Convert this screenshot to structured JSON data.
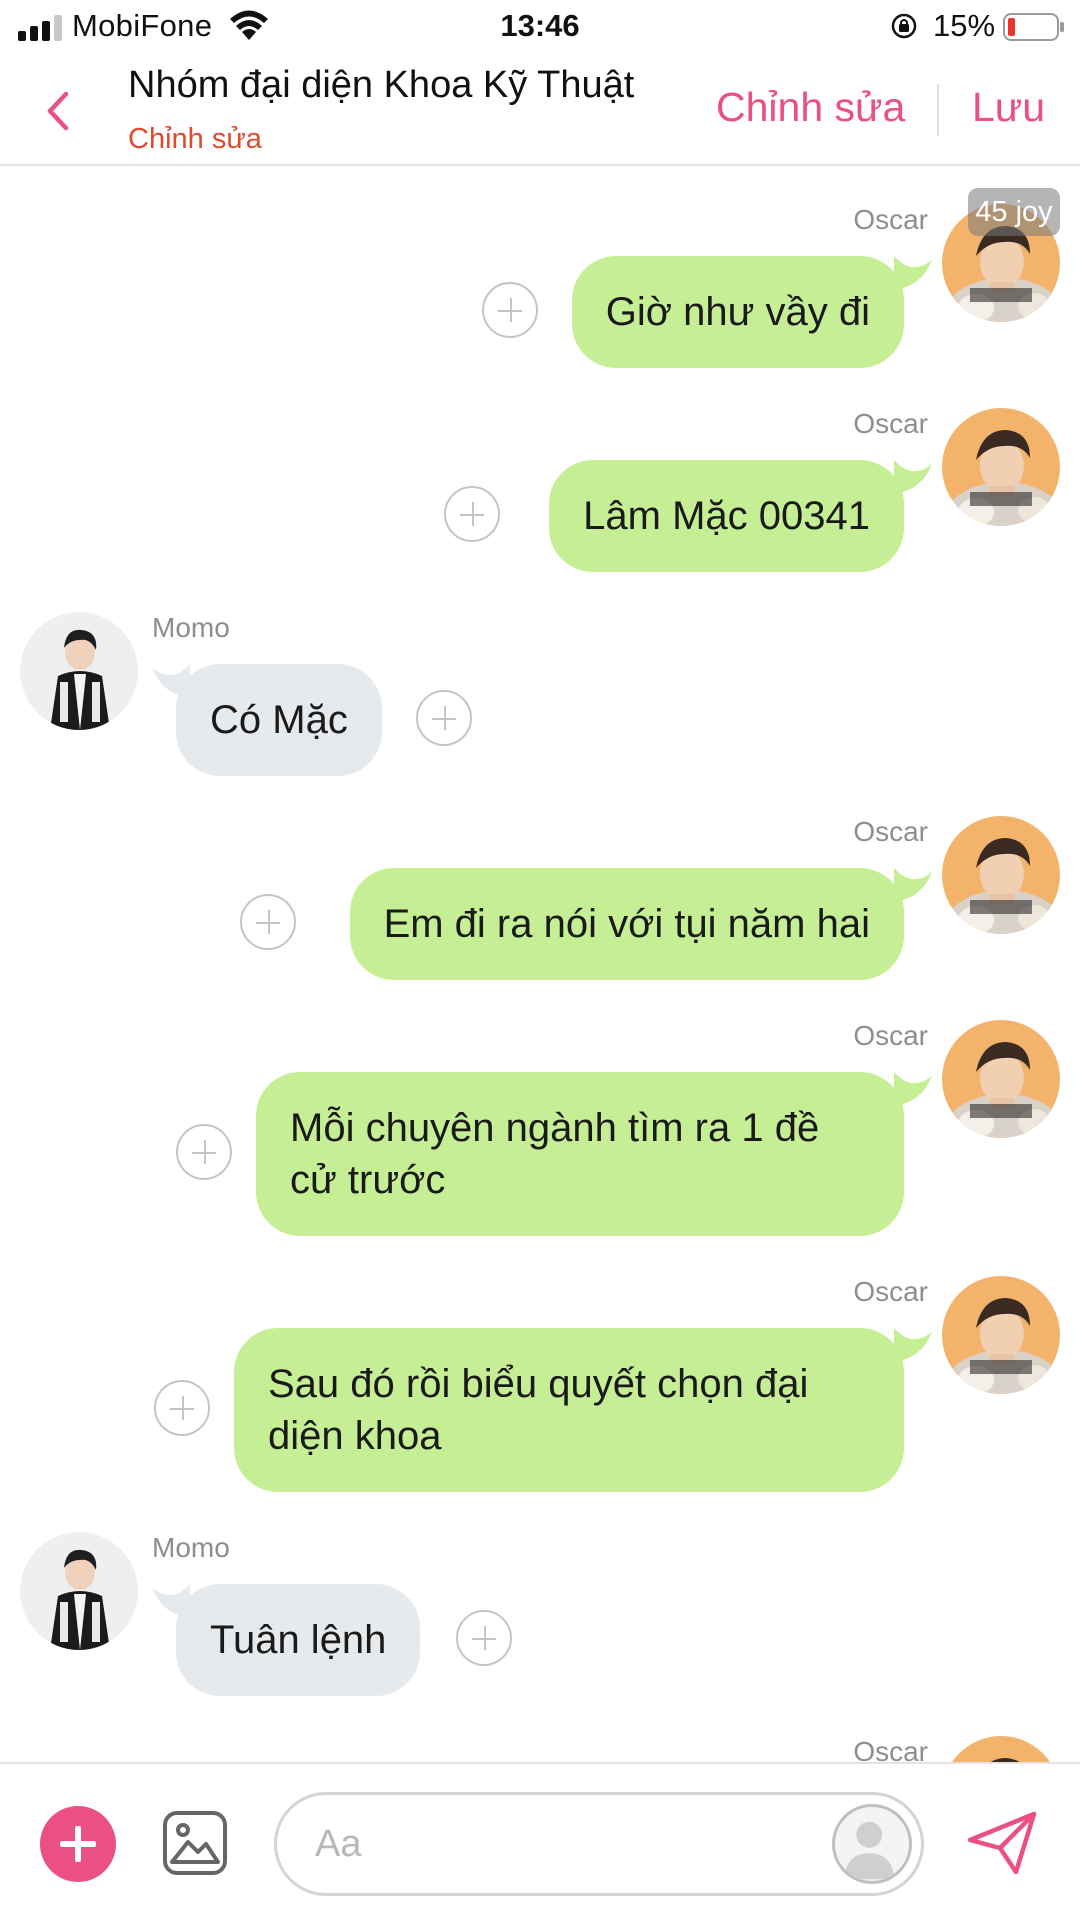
{
  "status_bar": {
    "carrier": "MobiFone",
    "time": "13:46",
    "battery": "15%",
    "icons": [
      "signal-icon",
      "wifi-icon",
      "rotation-lock-icon",
      "battery-icon"
    ]
  },
  "header": {
    "title": "Nhóm đại diện Khoa Kỹ Thuật",
    "subtitle": "Chỉnh sửa",
    "edit_label": "Chỉnh sửa",
    "save_label": "Lưu",
    "accent_color": "#ea4f85"
  },
  "badge": "45 joy",
  "messages": [
    {
      "sender": "Oscar",
      "direction": "out",
      "text": "Giờ như vầy đi"
    },
    {
      "sender": "Oscar",
      "direction": "out",
      "text": "Lâm Mặc 00341"
    },
    {
      "sender": "Momo",
      "direction": "in",
      "text": "Có Mặc"
    },
    {
      "sender": "Oscar",
      "direction": "out",
      "text": "Em đi ra nói với tụi năm hai"
    },
    {
      "sender": "Oscar",
      "direction": "out",
      "text": "Mỗi chuyên ngành tìm ra 1 đề cử trước"
    },
    {
      "sender": "Oscar",
      "direction": "out",
      "text": "Sau đó rồi biểu quyết chọn đại diện khoa"
    },
    {
      "sender": "Momo",
      "direction": "in",
      "text": "Tuân lệnh"
    },
    {
      "sender": "Oscar",
      "direction": "out",
      "text": ""
    }
  ],
  "composer": {
    "placeholder": "Aa",
    "icons": [
      "plus-icon",
      "image-icon",
      "avatar-icon",
      "send-icon"
    ]
  },
  "colors": {
    "outgoing_bubble": "#c6ef95",
    "incoming_bubble": "#e7eaed",
    "subtitle": "#e04a2f"
  }
}
